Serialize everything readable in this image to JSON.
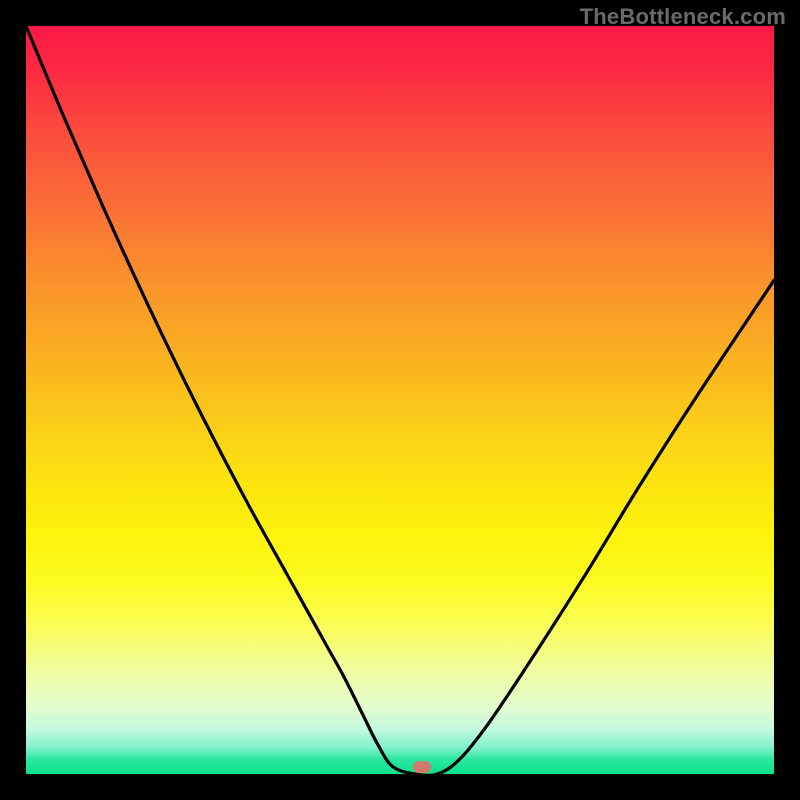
{
  "watermark": "TheBottleneck.com",
  "colors": {
    "frame": "#000000",
    "curve": "#000000",
    "dot": "#cf7a6d",
    "watermark": "#6a6a6a"
  },
  "chart_data": {
    "type": "line",
    "title": "",
    "xlabel": "",
    "ylabel": "",
    "xlim": [
      0,
      100
    ],
    "ylim": [
      0,
      100
    ],
    "grid": false,
    "series": [
      {
        "name": "curve",
        "x": [
          0,
          5,
          10,
          15,
          20,
          25,
          30,
          35,
          40,
          42.5,
          45,
          47,
          49,
          52,
          55,
          58,
          62,
          68,
          75,
          82,
          90,
          100
        ],
        "y": [
          100,
          88,
          76.5,
          65.5,
          55,
          45,
          35.5,
          26.5,
          17.5,
          13,
          8,
          4,
          1,
          0,
          0,
          2,
          7,
          16,
          27,
          38.5,
          51,
          66
        ]
      }
    ],
    "annotations": [
      {
        "name": "bottleneck-dot",
        "x": 53,
        "y": 1
      }
    ],
    "gradient_stops": [
      {
        "pos": 0.0,
        "color": "#fd1946"
      },
      {
        "pos": 0.24,
        "color": "#fb6e37"
      },
      {
        "pos": 0.46,
        "color": "#fab61f"
      },
      {
        "pos": 0.68,
        "color": "#fdf30c"
      },
      {
        "pos": 0.86,
        "color": "#f1fd9e"
      },
      {
        "pos": 0.96,
        "color": "#80f1cc"
      },
      {
        "pos": 1.0,
        "color": "#08e28c"
      }
    ]
  }
}
